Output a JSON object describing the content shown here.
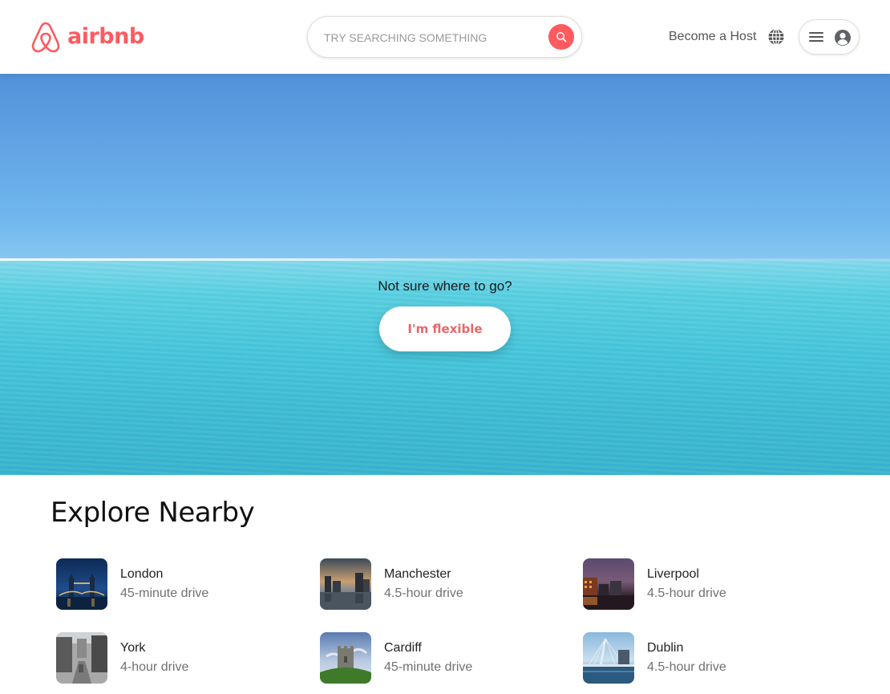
{
  "brand": {
    "name": "airbnb",
    "color": "#ff5a5f",
    "logo_icon": "airbnb-belo-icon"
  },
  "search": {
    "placeholder": "TRY SEARCHING SOMETHING",
    "value": "",
    "button_icon": "search-icon"
  },
  "nav": {
    "become_host": "Become a Host",
    "globe_icon": "globe-icon",
    "menu_icon": "hamburger-menu-icon",
    "avatar_icon": "user-avatar-icon"
  },
  "hero": {
    "question": "Not sure where to go?",
    "button_label": "I'm flexible",
    "button_color": "#e8676b"
  },
  "explore": {
    "title": "Explore Nearby",
    "places": [
      {
        "name": "London",
        "distance": "45-minute drive",
        "thumb": "london-tower-bridge-night"
      },
      {
        "name": "Manchester",
        "distance": "4.5-hour drive",
        "thumb": "manchester-skyline-sunset"
      },
      {
        "name": "Liverpool",
        "distance": "4.5-hour drive",
        "thumb": "liverpool-waterfront-dusk"
      },
      {
        "name": "York",
        "distance": "4-hour drive",
        "thumb": "york-street"
      },
      {
        "name": "Cardiff",
        "distance": "45-minute drive",
        "thumb": "cardiff-castle-keep"
      },
      {
        "name": "Dublin",
        "distance": "4.5-hour drive",
        "thumb": "dublin-samuel-beckett-bridge"
      }
    ]
  }
}
